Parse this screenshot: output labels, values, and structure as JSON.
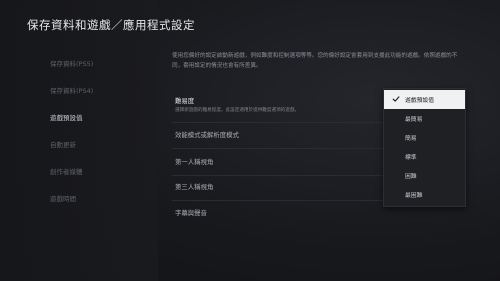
{
  "header": {
    "title": "保存資料和遊戲／應用程式設定"
  },
  "sidebar": {
    "items": [
      {
        "label": "保存資料(PS5)"
      },
      {
        "label": "保存資料(PS4)"
      },
      {
        "label": "遊戲預設值"
      },
      {
        "label": "自動更新"
      },
      {
        "label": "創作者媒體"
      },
      {
        "label": "遊戲時間"
      }
    ]
  },
  "main": {
    "description": "使用您偏好的設定啟動新遊戲，例如難度和控制選項等等。您的偏好設定會套用到支援此功能的遊戲。依照遊戲的不同，套用設定的情況也會有所差異。",
    "rows": [
      {
        "label": "難易度",
        "sub": "選擇新遊戲的難易程度。此設定適用於提供難度選項的遊戲。"
      },
      {
        "label": "效能模式或解析度模式"
      },
      {
        "label": "第一人稱視角"
      },
      {
        "label": "第三人稱視角"
      },
      {
        "label": "字幕與聲音"
      }
    ]
  },
  "dropdown": {
    "options": [
      {
        "label": "遊戲預設值",
        "selected": true
      },
      {
        "label": "最簡易"
      },
      {
        "label": "簡易"
      },
      {
        "label": "標準"
      },
      {
        "label": "困難"
      },
      {
        "label": "最困難"
      }
    ]
  },
  "icons": {
    "check": "check-icon"
  },
  "colors": {
    "selected_bg": "#f0f1f3",
    "background": "#15161a"
  }
}
